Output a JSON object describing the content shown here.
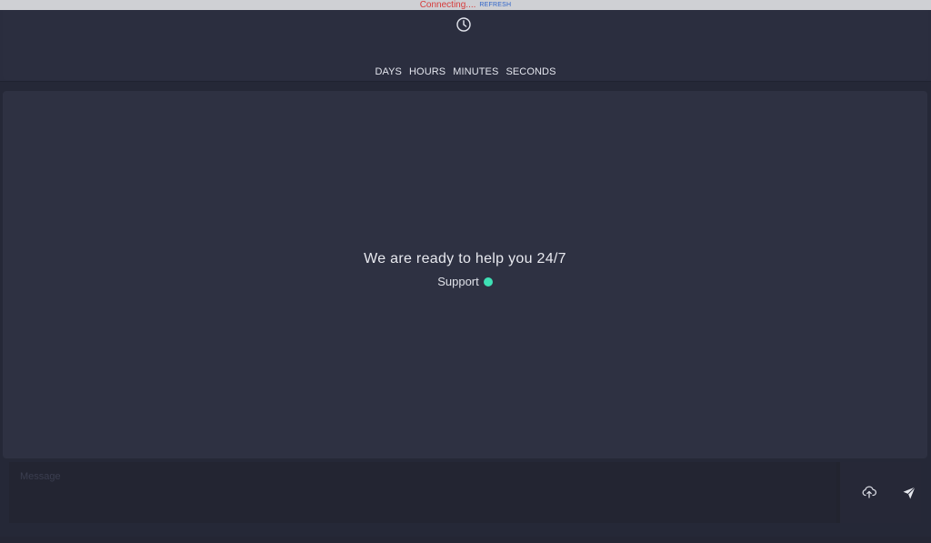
{
  "status": {
    "message": "Connecting....",
    "refresh_label": "REFRESH",
    "message_color": "#d63a3a",
    "link_color": "#2e63c9"
  },
  "timer": {
    "icon": "clock-icon",
    "units": [
      "DAYS",
      "HOURS",
      "MINUTES",
      "SECONDS"
    ]
  },
  "chat": {
    "welcome_text": "We are ready to help you 24/7",
    "support_label": "Support",
    "support_status_color": "#3ee0b5"
  },
  "composer": {
    "placeholder": "Message",
    "upload_icon": "cloud-upload-icon",
    "send_icon": "send-icon"
  },
  "colors": {
    "background": "#252837",
    "panel": "#2e3142",
    "accent_online": "#3ee0b5"
  }
}
